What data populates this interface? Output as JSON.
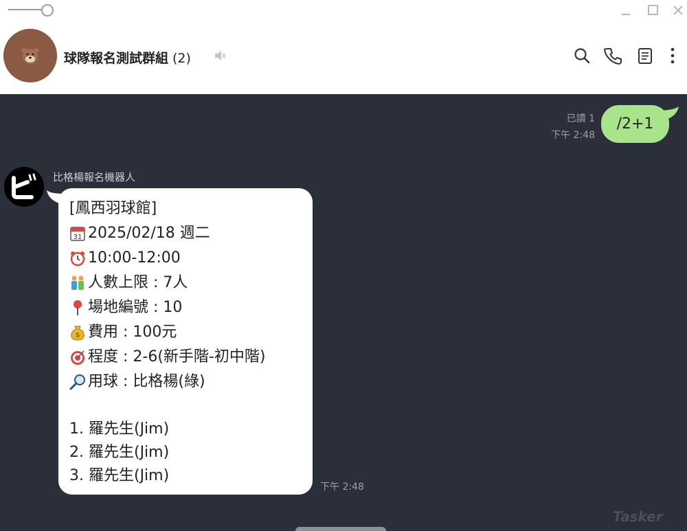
{
  "window": {
    "controls": [
      "minimize-icon",
      "maximize-icon",
      "close-icon"
    ]
  },
  "header": {
    "title": "球隊報名測試群組",
    "member_count": "(2)",
    "icons": [
      "search-icon",
      "phone-icon",
      "notes-icon",
      "more-icon",
      "mute-icon"
    ]
  },
  "chat": {
    "outgoing": {
      "text": "/2+1",
      "read_status": "已讀 1",
      "time": "下午 2:48"
    },
    "incoming": {
      "sender": "比格楊報名機器人",
      "avatar_text": "ビ",
      "time": "下午 2:48",
      "lines": [
        {
          "icon": "",
          "text": "[鳳西羽球館]"
        },
        {
          "icon": "calendar-icon",
          "text": "2025/02/18 週二"
        },
        {
          "icon": "alarm-clock-icon",
          "text": "10:00-12:00"
        },
        {
          "icon": "people-icon",
          "text": "人數上限 : 7人"
        },
        {
          "icon": "pin-icon",
          "text": "場地編號 : 10"
        },
        {
          "icon": "money-bag-icon",
          "text": "費用 : 100元"
        },
        {
          "icon": "target-icon",
          "text": "程度 : 2-6(新手階-初中階)"
        },
        {
          "icon": "magnifier-icon",
          "text": "用球 : 比格楊(綠)"
        }
      ],
      "list": [
        "1. 羅先生(Jim)",
        "2. 羅先生(Jim)",
        "3. 羅先生(Jim)"
      ]
    }
  },
  "watermark": "Tasker",
  "colors": {
    "chat_bg": "#2b2f3a",
    "outgoing_bubble": "#a8e58a",
    "incoming_bubble": "#ffffff"
  }
}
